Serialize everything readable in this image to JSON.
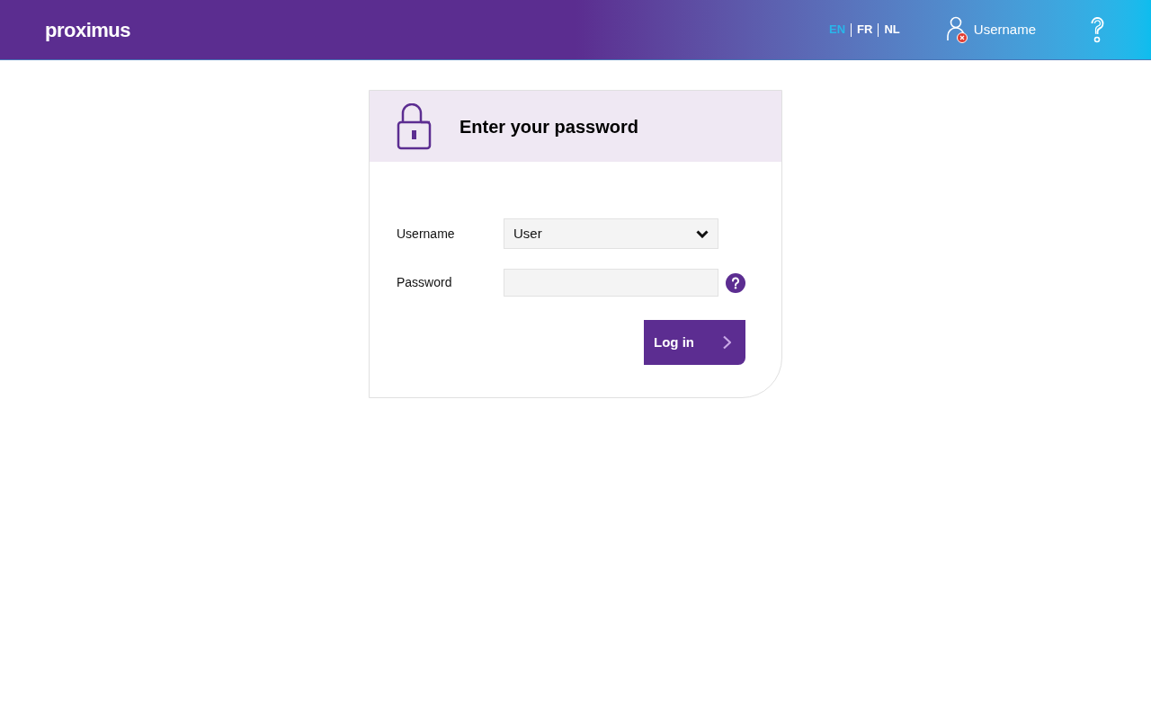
{
  "header": {
    "logo": "proximus",
    "languages": [
      {
        "label": "EN",
        "selected": true
      },
      {
        "label": "FR",
        "selected": false
      },
      {
        "label": "NL",
        "selected": false
      }
    ],
    "user": {
      "label": "Username",
      "alert": true
    }
  },
  "login_card": {
    "title": "Enter your password",
    "fields": [
      {
        "kind": "select",
        "label": "Username",
        "value": "User"
      },
      {
        "kind": "password",
        "label": "Password",
        "help_icon": true
      }
    ],
    "submit": {
      "label": "Log in"
    }
  }
}
